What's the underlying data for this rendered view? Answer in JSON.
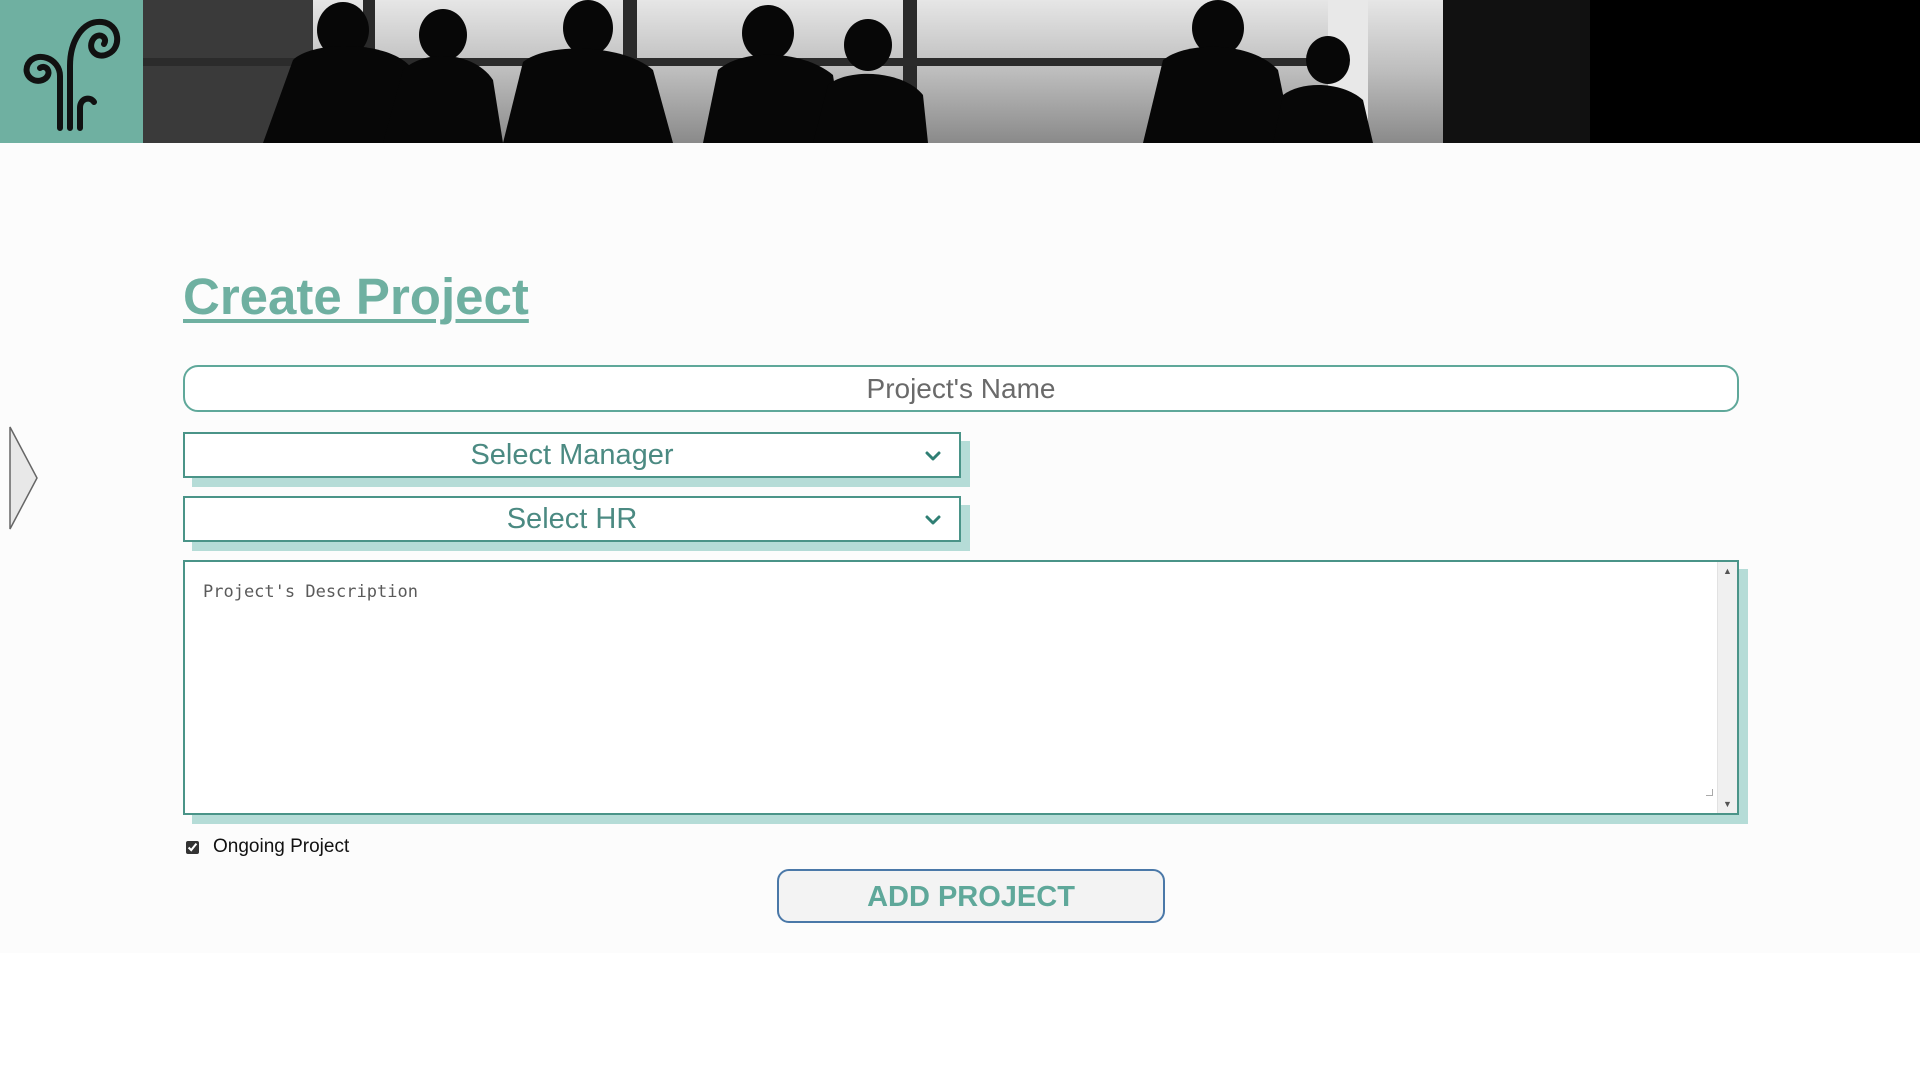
{
  "header": {
    "logo_icon": "spiral-logo-icon",
    "banner_image": "meeting-silhouettes-photo",
    "logo_color": "#6fb0a1"
  },
  "side_toggle_icon": "triangle-right-icon",
  "form": {
    "title": "Create Project",
    "project_name_placeholder": "Project's Name",
    "manager_select": {
      "selected": "Select Manager",
      "icon": "chevron-down-icon"
    },
    "hr_select": {
      "selected": "Select HR",
      "icon": "chevron-down-icon"
    },
    "description_placeholder": "Project's Description",
    "ongoing_label": "Ongoing Project",
    "ongoing_checked": true,
    "submit_label": "ADD PROJECT"
  },
  "colors": {
    "accent": "#6fb0a1",
    "border": "#4a9488",
    "shadow": "#b5dcd7",
    "button_border": "#4a78a8"
  }
}
